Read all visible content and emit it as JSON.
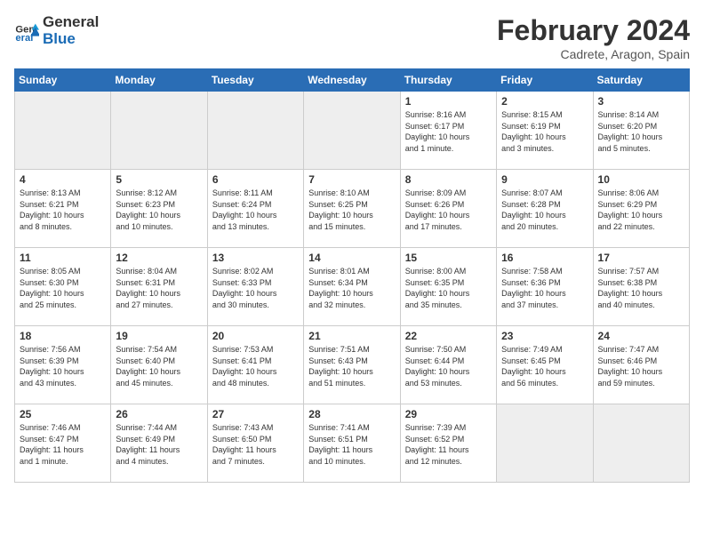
{
  "logo": {
    "line1": "General",
    "line2": "Blue"
  },
  "title": "February 2024",
  "subtitle": "Cadrete, Aragon, Spain",
  "weekdays": [
    "Sunday",
    "Monday",
    "Tuesday",
    "Wednesday",
    "Thursday",
    "Friday",
    "Saturday"
  ],
  "weeks": [
    [
      {
        "day": "",
        "info": ""
      },
      {
        "day": "",
        "info": ""
      },
      {
        "day": "",
        "info": ""
      },
      {
        "day": "",
        "info": ""
      },
      {
        "day": "1",
        "info": "Sunrise: 8:16 AM\nSunset: 6:17 PM\nDaylight: 10 hours\nand 1 minute."
      },
      {
        "day": "2",
        "info": "Sunrise: 8:15 AM\nSunset: 6:19 PM\nDaylight: 10 hours\nand 3 minutes."
      },
      {
        "day": "3",
        "info": "Sunrise: 8:14 AM\nSunset: 6:20 PM\nDaylight: 10 hours\nand 5 minutes."
      }
    ],
    [
      {
        "day": "4",
        "info": "Sunrise: 8:13 AM\nSunset: 6:21 PM\nDaylight: 10 hours\nand 8 minutes."
      },
      {
        "day": "5",
        "info": "Sunrise: 8:12 AM\nSunset: 6:23 PM\nDaylight: 10 hours\nand 10 minutes."
      },
      {
        "day": "6",
        "info": "Sunrise: 8:11 AM\nSunset: 6:24 PM\nDaylight: 10 hours\nand 13 minutes."
      },
      {
        "day": "7",
        "info": "Sunrise: 8:10 AM\nSunset: 6:25 PM\nDaylight: 10 hours\nand 15 minutes."
      },
      {
        "day": "8",
        "info": "Sunrise: 8:09 AM\nSunset: 6:26 PM\nDaylight: 10 hours\nand 17 minutes."
      },
      {
        "day": "9",
        "info": "Sunrise: 8:07 AM\nSunset: 6:28 PM\nDaylight: 10 hours\nand 20 minutes."
      },
      {
        "day": "10",
        "info": "Sunrise: 8:06 AM\nSunset: 6:29 PM\nDaylight: 10 hours\nand 22 minutes."
      }
    ],
    [
      {
        "day": "11",
        "info": "Sunrise: 8:05 AM\nSunset: 6:30 PM\nDaylight: 10 hours\nand 25 minutes."
      },
      {
        "day": "12",
        "info": "Sunrise: 8:04 AM\nSunset: 6:31 PM\nDaylight: 10 hours\nand 27 minutes."
      },
      {
        "day": "13",
        "info": "Sunrise: 8:02 AM\nSunset: 6:33 PM\nDaylight: 10 hours\nand 30 minutes."
      },
      {
        "day": "14",
        "info": "Sunrise: 8:01 AM\nSunset: 6:34 PM\nDaylight: 10 hours\nand 32 minutes."
      },
      {
        "day": "15",
        "info": "Sunrise: 8:00 AM\nSunset: 6:35 PM\nDaylight: 10 hours\nand 35 minutes."
      },
      {
        "day": "16",
        "info": "Sunrise: 7:58 AM\nSunset: 6:36 PM\nDaylight: 10 hours\nand 37 minutes."
      },
      {
        "day": "17",
        "info": "Sunrise: 7:57 AM\nSunset: 6:38 PM\nDaylight: 10 hours\nand 40 minutes."
      }
    ],
    [
      {
        "day": "18",
        "info": "Sunrise: 7:56 AM\nSunset: 6:39 PM\nDaylight: 10 hours\nand 43 minutes."
      },
      {
        "day": "19",
        "info": "Sunrise: 7:54 AM\nSunset: 6:40 PM\nDaylight: 10 hours\nand 45 minutes."
      },
      {
        "day": "20",
        "info": "Sunrise: 7:53 AM\nSunset: 6:41 PM\nDaylight: 10 hours\nand 48 minutes."
      },
      {
        "day": "21",
        "info": "Sunrise: 7:51 AM\nSunset: 6:43 PM\nDaylight: 10 hours\nand 51 minutes."
      },
      {
        "day": "22",
        "info": "Sunrise: 7:50 AM\nSunset: 6:44 PM\nDaylight: 10 hours\nand 53 minutes."
      },
      {
        "day": "23",
        "info": "Sunrise: 7:49 AM\nSunset: 6:45 PM\nDaylight: 10 hours\nand 56 minutes."
      },
      {
        "day": "24",
        "info": "Sunrise: 7:47 AM\nSunset: 6:46 PM\nDaylight: 10 hours\nand 59 minutes."
      }
    ],
    [
      {
        "day": "25",
        "info": "Sunrise: 7:46 AM\nSunset: 6:47 PM\nDaylight: 11 hours\nand 1 minute."
      },
      {
        "day": "26",
        "info": "Sunrise: 7:44 AM\nSunset: 6:49 PM\nDaylight: 11 hours\nand 4 minutes."
      },
      {
        "day": "27",
        "info": "Sunrise: 7:43 AM\nSunset: 6:50 PM\nDaylight: 11 hours\nand 7 minutes."
      },
      {
        "day": "28",
        "info": "Sunrise: 7:41 AM\nSunset: 6:51 PM\nDaylight: 11 hours\nand 10 minutes."
      },
      {
        "day": "29",
        "info": "Sunrise: 7:39 AM\nSunset: 6:52 PM\nDaylight: 11 hours\nand 12 minutes."
      },
      {
        "day": "",
        "info": ""
      },
      {
        "day": "",
        "info": ""
      }
    ]
  ]
}
